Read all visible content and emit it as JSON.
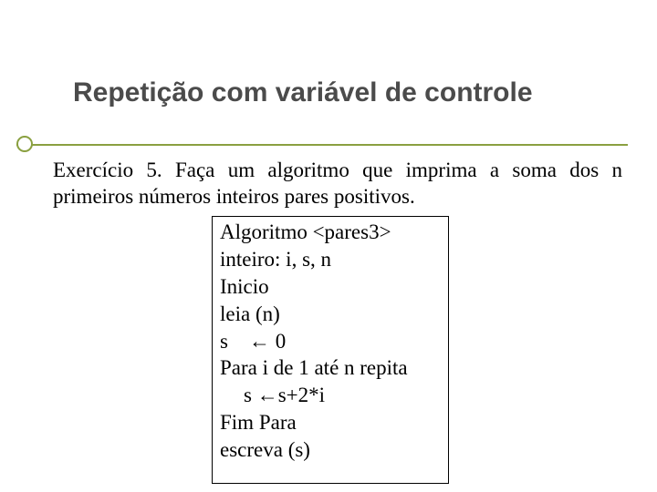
{
  "title": "Repetição com variável de controle",
  "problem": "Exercício 5. Faça um algoritmo que imprima a soma dos n primeiros números inteiros pares positivos.",
  "code": {
    "l1": "Algoritmo <pares3>",
    "l2": "inteiro: i, s, n",
    "l3": "Inicio",
    "l4": "leia (n)",
    "l5": "s    ← 0",
    "l6": "Para i de 1 até n repita",
    "l7": "s ←s+2*i",
    "l8": "Fim Para",
    "l9": "escreva (s)"
  }
}
